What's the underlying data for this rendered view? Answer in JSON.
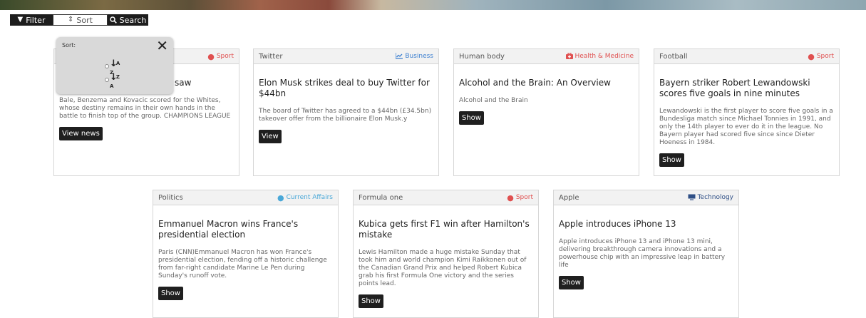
{
  "toolbar": {
    "filter_label": "Filter",
    "sort_label": "Sort",
    "search_label": "Search"
  },
  "sort_popup": {
    "title": "Sort:",
    "close": "✕"
  },
  "cards": [
    {
      "topic": "",
      "category": "Sport",
      "category_color": "#e05050",
      "title": "saw",
      "text": "Bale, Benzema and Kovacic scored for the Whites, whose destiny remains in their own hands in the battle to finish top of the group. CHAMPIONS LEAGUE",
      "button": "View news"
    },
    {
      "topic": "Twitter",
      "category": "Business",
      "category_color": "#3c7fd0",
      "title": "Elon Musk strikes deal to buy Twitter for $44bn",
      "text": "The board of Twitter has agreed to a $44bn (£34.5bn) takeover offer from the billionaire Elon Musk.y",
      "button": "View"
    },
    {
      "topic": "Human body",
      "category": "Health & Medicine",
      "category_color": "#e05050",
      "title": "Alcohol and the Brain: An Overview",
      "text": "Alcohol and the Brain",
      "button": "Show"
    },
    {
      "topic": "Football",
      "category": "Sport",
      "category_color": "#e05050",
      "title": "Bayern striker Robert Lewandowski scores five goals in nine minutes",
      "text": "Lewandowski is the first player to score five goals in a Bundesliga match since Michael Tonnies in 1991, and only the 14th player to ever do it in the league. No Bayern player had scored five since since Dieter Hoeness in 1984.",
      "button": "Show"
    },
    {
      "topic": "Politics",
      "category": "Current Affairs",
      "category_color": "#4aa8d8",
      "title": "Emmanuel Macron wins France's presidential election",
      "text": "Paris (CNN)Emmanuel Macron has won France's presidential election, fending off a historic challenge from far-right candidate Marine Le Pen during Sunday's runoff vote.",
      "button": "Show"
    },
    {
      "topic": "Formula one",
      "category": "Sport",
      "category_color": "#e05050",
      "title": "Kubica gets first F1 win after Hamilton's mistake",
      "text": "Lewis Hamilton made a huge mistake Sunday that took him and world champion Kimi Raikkonen out of the Canadian Grand Prix and helped Robert Kubica grab his first Formula One victory and the series points lead.",
      "button": "Show"
    },
    {
      "topic": "Apple",
      "category": "Technology",
      "category_color": "#2f4f86",
      "title": "Apple introduces iPhone 13",
      "text": "Apple introduces iPhone 13 and iPhone 13 mini, delivering breakthrough camera innovations and a powerhouse chip with an impressive leap in battery life",
      "button": "Show"
    }
  ]
}
